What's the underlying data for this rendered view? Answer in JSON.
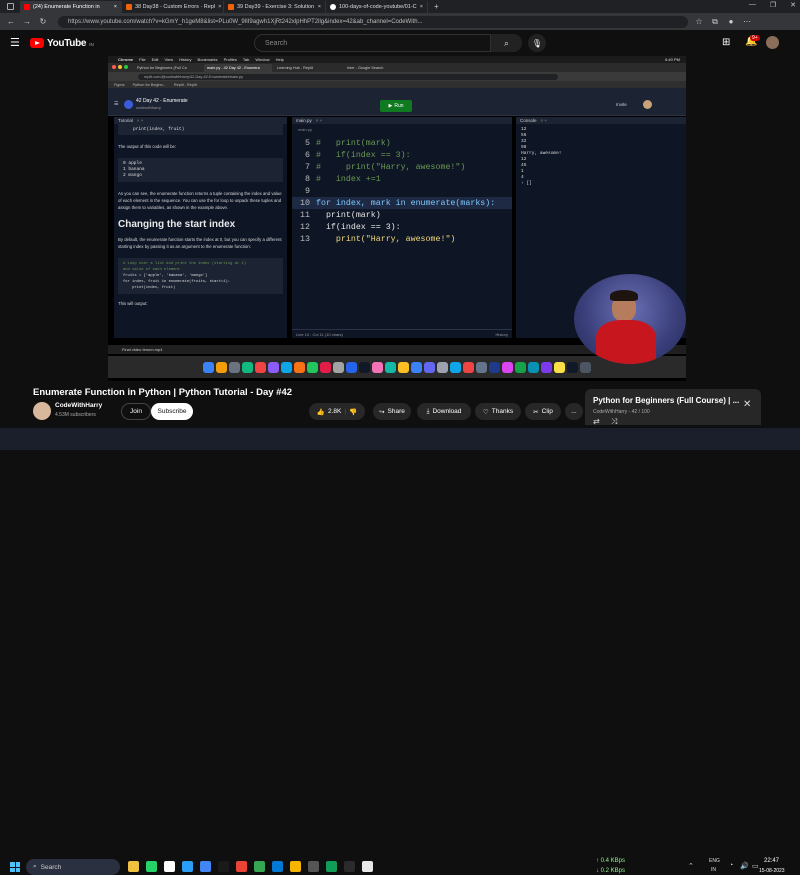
{
  "browser": {
    "tabs": [
      {
        "label": "(24) Enumerate Function in"
      },
      {
        "label": "38 Day38 - Custom Errors · Repl"
      },
      {
        "label": "39 Day39 - Exercise 3: Solution"
      },
      {
        "label": "100-days-of-code-youtube/01-C"
      }
    ],
    "url": "https://www.youtube.com/watch?v=kGmY_h1geM8&list=PLu0W_9lII9agwh1XjRt242xlpHhPT2llg&index=42&ab_channel=CodeWith..."
  },
  "youtube": {
    "logo_text": "YouTube",
    "logo_sup": "IN",
    "search_placeholder": "Search",
    "notification_count": "9+",
    "video": {
      "mac_menu": [
        "Chrome",
        "File",
        "Edit",
        "View",
        "History",
        "Bookmarks",
        "Profiles",
        "Tab",
        "Window",
        "Help"
      ],
      "mac_time": "6:40 PM",
      "mac_tabs": [
        "Python for Beginners (Full Co",
        "main.py - 42 Day 42 - Enumera",
        "Learning Hub - Replit",
        "Inter - Google Search"
      ],
      "mac_url": "replit.com/@codewithharry/42-Day-42-Enumerate#main.py",
      "bookmarks": [
        "Figma",
        "Python for Beginn...",
        "Replit - Replit"
      ],
      "replit_title": "42 Day 42 - Enumerate",
      "replit_user": "codewithharry",
      "run_label": "Run",
      "invite_label": "Invite",
      "tutorial_tab": "Tutorial",
      "tutorial": {
        "code1": "print(index, fruit)",
        "p1": "The output of this code will be:",
        "output": [
          "0 apple",
          "1 banana",
          "2 mango"
        ],
        "p2": "As you can see, the enumerate function returns a tuple containing the index and value of each element in the sequence. You can use the for loop to unpack these tuples and assign them to variables, as shown in the example above.",
        "heading": "Changing the start index",
        "p3": "By default, the enumerate function starts the index at 0, but you can specify a different starting index by passing it as an argument to the enumerate function:",
        "code2": [
          "# Loop over a list and print the index (starting at 1)",
          "and value of each element",
          "fruits = ['apple', 'banana', 'mango']",
          "for index, fruit in enumerate(fruits, start=1):",
          "    print(index, fruit)"
        ],
        "p4": "This will output:"
      },
      "editor_tab": "main.py",
      "editor_breadcrumb": "main.py",
      "code_lines": [
        {
          "n": "5",
          "t": "#   print(mark)"
        },
        {
          "n": "6",
          "t": "#   if(index == 3):"
        },
        {
          "n": "7",
          "t": "#     print(\"Harry, awesome!\")"
        },
        {
          "n": "8",
          "t": "#   index +=1"
        },
        {
          "n": "9",
          "t": ""
        },
        {
          "n": "10",
          "t": "for index, mark in enumerate(marks):"
        },
        {
          "n": "11",
          "t": "  print(mark)"
        },
        {
          "n": "12",
          "t": "  if(index == 3):"
        },
        {
          "n": "13",
          "t": "    print(\"Harry, awesome!\")"
        }
      ],
      "status": "Line 10 : Col 11 (10 chars)",
      "history": "History",
      "console_tab": "Console",
      "console_lines": [
        "12",
        "56",
        "32",
        "98",
        "Harry, awesome!",
        "12",
        "45",
        "1",
        "4",
        "› []"
      ],
      "download_bar": "Final video tenum.mp4"
    },
    "title": "Enumerate Function in Python | Python Tutorial - Day #42",
    "channel": {
      "name": "CodeWithHarry",
      "subs": "4.53M subscribers"
    },
    "join_label": "Join",
    "subscribe_label": "Subscribe",
    "likes": "2.8K",
    "share_label": "Share",
    "download_label": "Download",
    "thanks_label": "Thanks",
    "clip_label": "Clip",
    "more_label": "...",
    "playlist": {
      "title": "Python for Beginners (Full Course) | ...",
      "meta": "CodeWithHarry - 42 / 100"
    }
  },
  "taskbar": {
    "search_placeholder": "Search",
    "net_up": "↑ 0.4 KBps",
    "net_down": "↓ 0.2 KBps",
    "lang": "ENG",
    "region": "IN",
    "time": "22:47",
    "date": "15-08-2023"
  }
}
